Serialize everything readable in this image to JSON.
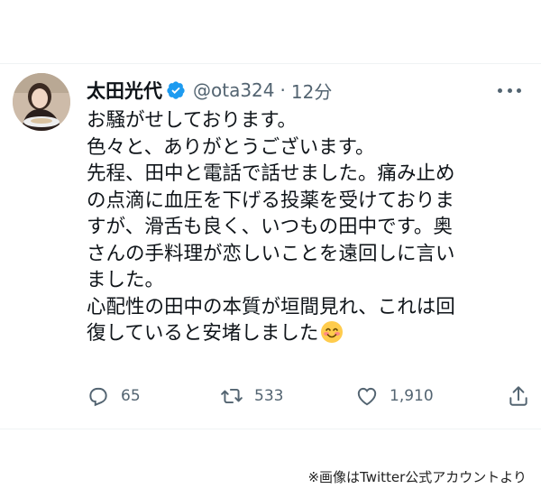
{
  "tweet": {
    "author_name": "太田光代",
    "handle": "@ota324",
    "separator": "·",
    "time": "12分",
    "lines": [
      "お騒がせしております。",
      "色々と、ありがとうございます。",
      "先程、田中と電話で話せました。痛み止め",
      "の点滴に血圧を下げる投薬を受けておりま",
      "すが、滑舌も良く、いつもの田中です。奥",
      "さんの手料理が恋しいことを遠回しに言い",
      "ました。",
      "心配性の田中の本質が垣間見れ、これは回",
      "復していると安堵しました"
    ],
    "icons": {
      "avatar": "profile-photo",
      "verified": "verified-badge-icon",
      "more": "more-options-icon",
      "emoji": "smiling-face-emoji",
      "reply": "reply-icon",
      "retweet": "retweet-icon",
      "like": "heart-icon",
      "share": "share-icon"
    },
    "colors": {
      "verified": "#1d9bf0",
      "text": "#0f1419",
      "secondary": "#536471"
    },
    "actions": {
      "reply_count": "65",
      "retweet_count": "533",
      "like_count": "1,910"
    }
  },
  "caption": "※画像はTwitter公式アカウントより"
}
